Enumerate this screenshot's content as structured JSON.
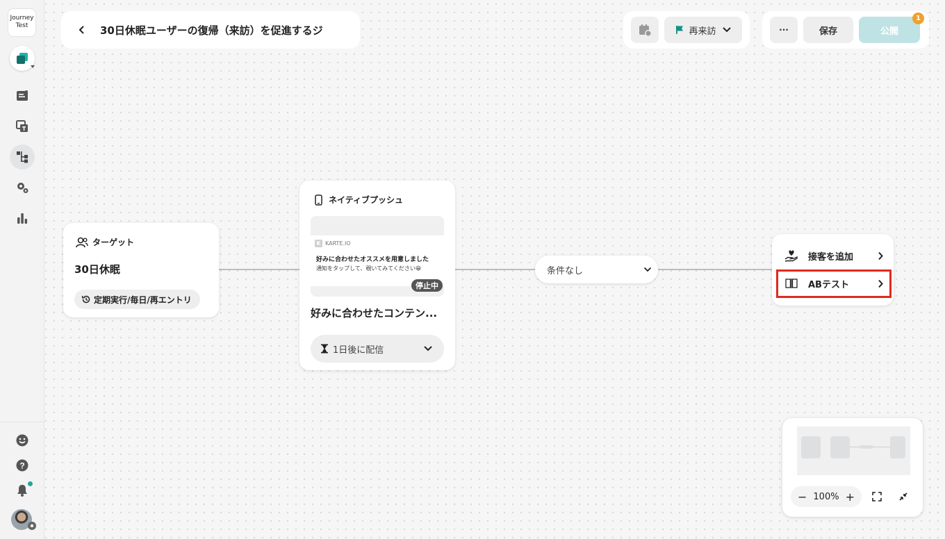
{
  "sidebar": {
    "logo_line1": "Journey",
    "logo_line2": "Test"
  },
  "header": {
    "title": "30日休眠ユーザーの復帰（来訪）を促進するジ",
    "goal_label": "再来訪",
    "more_label": "···",
    "save_label": "保存",
    "publish_label": "公開",
    "publish_badge": "1"
  },
  "target_node": {
    "label": "ターゲット",
    "value": "30日休眠",
    "schedule": "定期実行/毎日/再エントリ"
  },
  "push_node": {
    "label": "ネイティブプッシュ",
    "app_name": "KARTE.IO",
    "push_title": "好みに合わせたオススメを用意しました",
    "push_body": "通知をタップして、覗いてみてください😁",
    "status": "停止中",
    "name": "好みに合わせたコンテン...",
    "delay": "1日後に配信"
  },
  "condition": {
    "label": "条件なし"
  },
  "add_menu": {
    "add_action": "接客を追加",
    "ab_test": "ABテスト"
  },
  "minimap": {
    "zoom": "100%",
    "zoom_out": "−",
    "zoom_in": "+"
  },
  "colors": {
    "accent": "#20a7a0",
    "publish": "#bfe3e4",
    "badge": "#f0a02c",
    "highlight": "#e02a1f"
  }
}
